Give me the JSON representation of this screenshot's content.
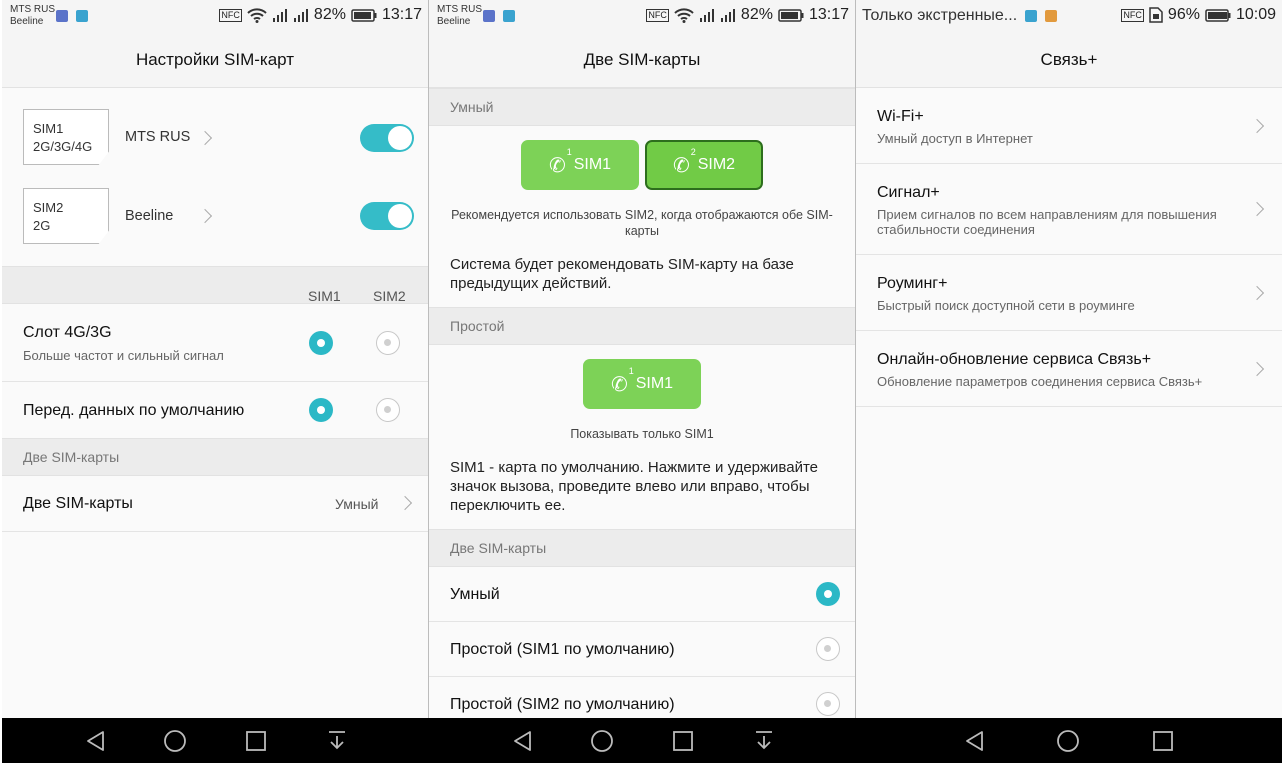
{
  "screen1": {
    "status": {
      "carrier1": "MTS RUS",
      "carrier2": "Beeline",
      "battery": "82%",
      "time": "13:17"
    },
    "title": "Настройки SIM-карт",
    "sims": [
      {
        "name": "SIM1",
        "tech": "2G/3G/4G",
        "operator": "MTS RUS",
        "enabled": true
      },
      {
        "name": "SIM2",
        "tech": "2G",
        "operator": "Beeline",
        "enabled": true
      }
    ],
    "col_sim1": "SIM1",
    "col_sim2": "SIM2",
    "slot_title": "Слот 4G/3G",
    "slot_sub": "Больше частот и сильный сигнал",
    "data_default": "Перед. данных по умолчанию",
    "section_dual": "Две SIM-карты",
    "dual_title": "Две SIM-карты",
    "dual_value": "Умный"
  },
  "screen2": {
    "status": {
      "carrier1": "MTS RUS",
      "carrier2": "Beeline",
      "battery": "82%",
      "time": "13:17"
    },
    "title": "Две SIM-карты",
    "section_smart": "Умный",
    "btn_sim1": "SIM1",
    "btn_sim2": "SIM2",
    "badge1": "1",
    "badge2": "2",
    "smart_caption": "Рекомендуется использовать SIM2, когда отображаются обе SIM-карты",
    "smart_desc": "Система будет рекомендовать SIM-карту на базе предыдущих действий.",
    "section_simple": "Простой",
    "simple_btn": "SIM1",
    "simple_caption": "Показывать только SIM1",
    "simple_desc": "SIM1 - карта по умолчанию. Нажмите и удерживайте значок вызова, проведите влево или вправо, чтобы переключить ее.",
    "section_dual": "Две SIM-карты",
    "options": [
      "Умный",
      "Простой (SIM1 по умолчанию)",
      "Простой (SIM2 по умолчанию)"
    ]
  },
  "screen3": {
    "status": {
      "notice": "Только экстренные...",
      "battery": "96%",
      "time": "10:09"
    },
    "title": "Связь+",
    "items": [
      {
        "title": "Wi-Fi+",
        "sub": "Умный доступ в Интернет"
      },
      {
        "title": "Сигнал+",
        "sub": "Прием сигналов по всем направлениям для повышения стабильности соединения"
      },
      {
        "title": "Роуминг+",
        "sub": "Быстрый поиск доступной сети в роуминге"
      },
      {
        "title": "Онлайн-обновление сервиса Связь+",
        "sub": "Обновление параметров соединения сервиса Связь+"
      }
    ]
  },
  "colors": {
    "accent": "#2bb8c6",
    "green": "#7dd257",
    "navbar": "#000000"
  }
}
